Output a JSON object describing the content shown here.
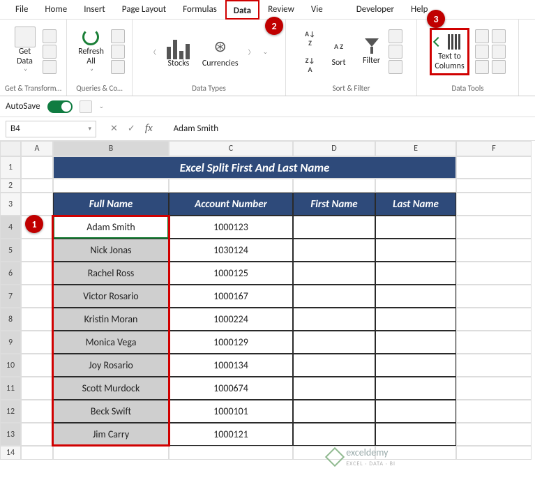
{
  "tabs": {
    "file": "File",
    "home": "Home",
    "insert": "Insert",
    "page_layout": "Page Layout",
    "formulas": "Formulas",
    "data": "Data",
    "review": "Review",
    "view": "Vie",
    "developer": "Developer",
    "help": "Help"
  },
  "ribbon": {
    "get_data": "Get\nData",
    "get_transform": "Get & Transform…",
    "refresh_all": "Refresh\nAll",
    "queries_co": "Queries & Co…",
    "stocks": "Stocks",
    "currencies": "Currencies",
    "data_types": "Data Types",
    "sort": "Sort",
    "filter": "Filter",
    "sort_filter": "Sort & Filter",
    "text_to_columns": "Text to\nColumns",
    "data_tools": "Data Tools",
    "az": "A\nZ",
    "za": "Z\nA"
  },
  "autosave": {
    "label": "AutoSave"
  },
  "namebox": {
    "value": "B4"
  },
  "formula": {
    "fx": "fx",
    "value": "Adam Smith"
  },
  "columns": {
    "A": "A",
    "B": "B",
    "C": "C",
    "D": "D",
    "E": "E",
    "F": "F"
  },
  "row_nums": [
    "1",
    "2",
    "3",
    "4",
    "5",
    "6",
    "7",
    "8",
    "9",
    "10",
    "11",
    "12",
    "13",
    "14"
  ],
  "title": "Excel Split First And Last Name",
  "headers": {
    "fullname": "Full Name",
    "account": "Account Number",
    "first": "First Name",
    "last": "Last Name"
  },
  "data": [
    {
      "name": "Adam Smith",
      "acct": "1000123"
    },
    {
      "name": "Nick Jonas",
      "acct": "1030124"
    },
    {
      "name": "Rachel Ross",
      "acct": "1000125"
    },
    {
      "name": "Victor Rosario",
      "acct": "1000167"
    },
    {
      "name": "Kristin Moran",
      "acct": "1000224"
    },
    {
      "name": "Monica Vega",
      "acct": "1000129"
    },
    {
      "name": "Joy Rosario",
      "acct": "1000134"
    },
    {
      "name": "Scott Murdock",
      "acct": "1000674"
    },
    {
      "name": "Beck Swift",
      "acct": "1000101"
    },
    {
      "name": "Jim Carry",
      "acct": "1000121"
    }
  ],
  "callouts": {
    "c1": "1",
    "c2": "2",
    "c3": "3"
  },
  "watermark": {
    "brand": "exceldemy",
    "tag": "EXCEL · DATA · BI"
  }
}
